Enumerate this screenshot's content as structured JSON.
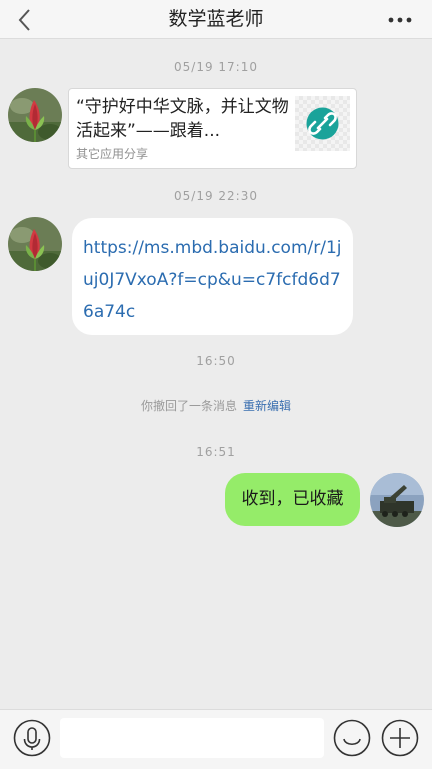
{
  "header": {
    "title": "数学蓝老师"
  },
  "messages": {
    "time_1": "05/19 17:10",
    "share_card": {
      "title": "“守护好中华文脉，并让文物活起来”——跟着...",
      "source": "其它应用分享",
      "thumb_icon": "link-icon"
    },
    "time_2": "05/19 22:30",
    "link": {
      "text": "https://ms.mbd.baidu.com/r/1juj0J7VxoA?f=cp&u=c7fcfd6d76a74c"
    },
    "time_3": "16:50",
    "recall": {
      "text": "你撤回了一条消息",
      "edit_label": "重新编辑"
    },
    "time_4": "16:51",
    "reply": {
      "text": "收到，已收藏"
    }
  },
  "composer": {
    "input_value": "",
    "voice_icon": "microphone-icon",
    "emoji_icon": "smiley-icon",
    "plus_icon": "plus-icon"
  },
  "colors": {
    "self_bubble": "#95ec69",
    "link_text": "#2b6cb0",
    "share_icon_bg": "#1aa39a"
  }
}
